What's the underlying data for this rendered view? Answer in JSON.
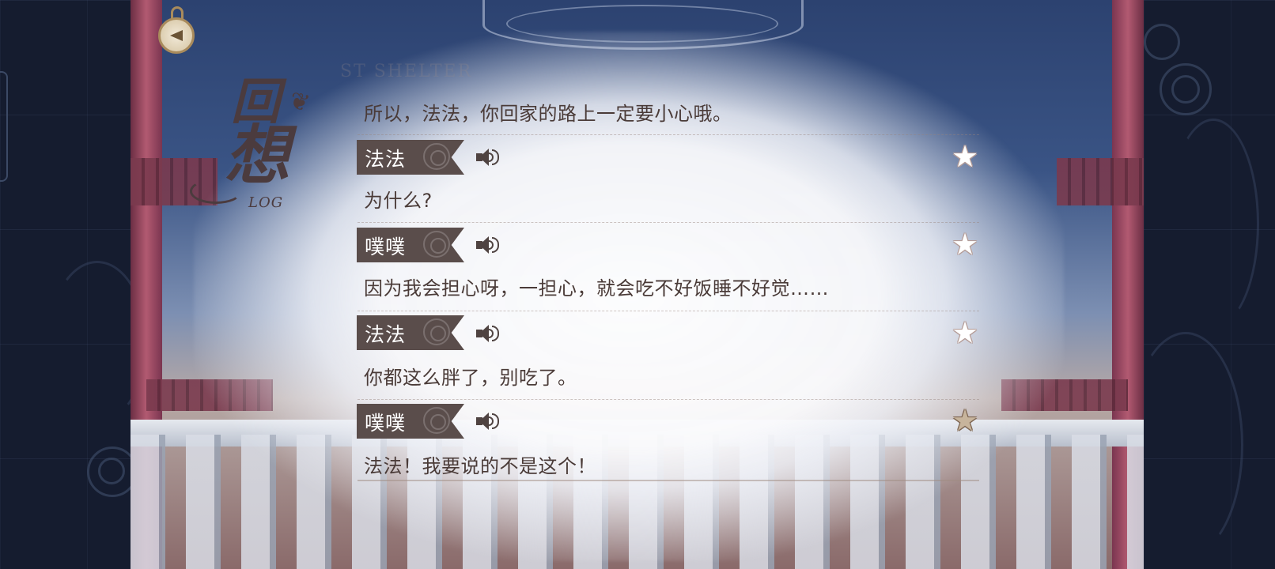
{
  "header": {
    "title_main": "回",
    "title_sub": "想",
    "title_en": "LOG",
    "watermark": "ST SHELTER"
  },
  "log": {
    "first_line": "所以，法法，你回家的路上一定要小心哦。",
    "entries": [
      {
        "speaker": "法法",
        "text": "为什么?",
        "favorited": false
      },
      {
        "speaker": "噗噗",
        "text": "因为我会担心呀，一担心，就会吃不好饭睡不好觉……",
        "favorited": false
      },
      {
        "speaker": "法法",
        "text": "你都这么胖了，别吃了。",
        "favorited": false
      },
      {
        "speaker": "噗噗",
        "text": "法法！我要说的不是这个！",
        "favorited": true
      }
    ]
  },
  "icons": {
    "home": "compass-back-icon",
    "voice": "speaker-icon",
    "favorite": "star-icon",
    "name_deco": "rose-icon"
  },
  "colors": {
    "text": "#4a3b38",
    "name_plate": "#5a4d4b",
    "star_on": "#c7b49c",
    "accent_gold": "#a98b5c"
  }
}
